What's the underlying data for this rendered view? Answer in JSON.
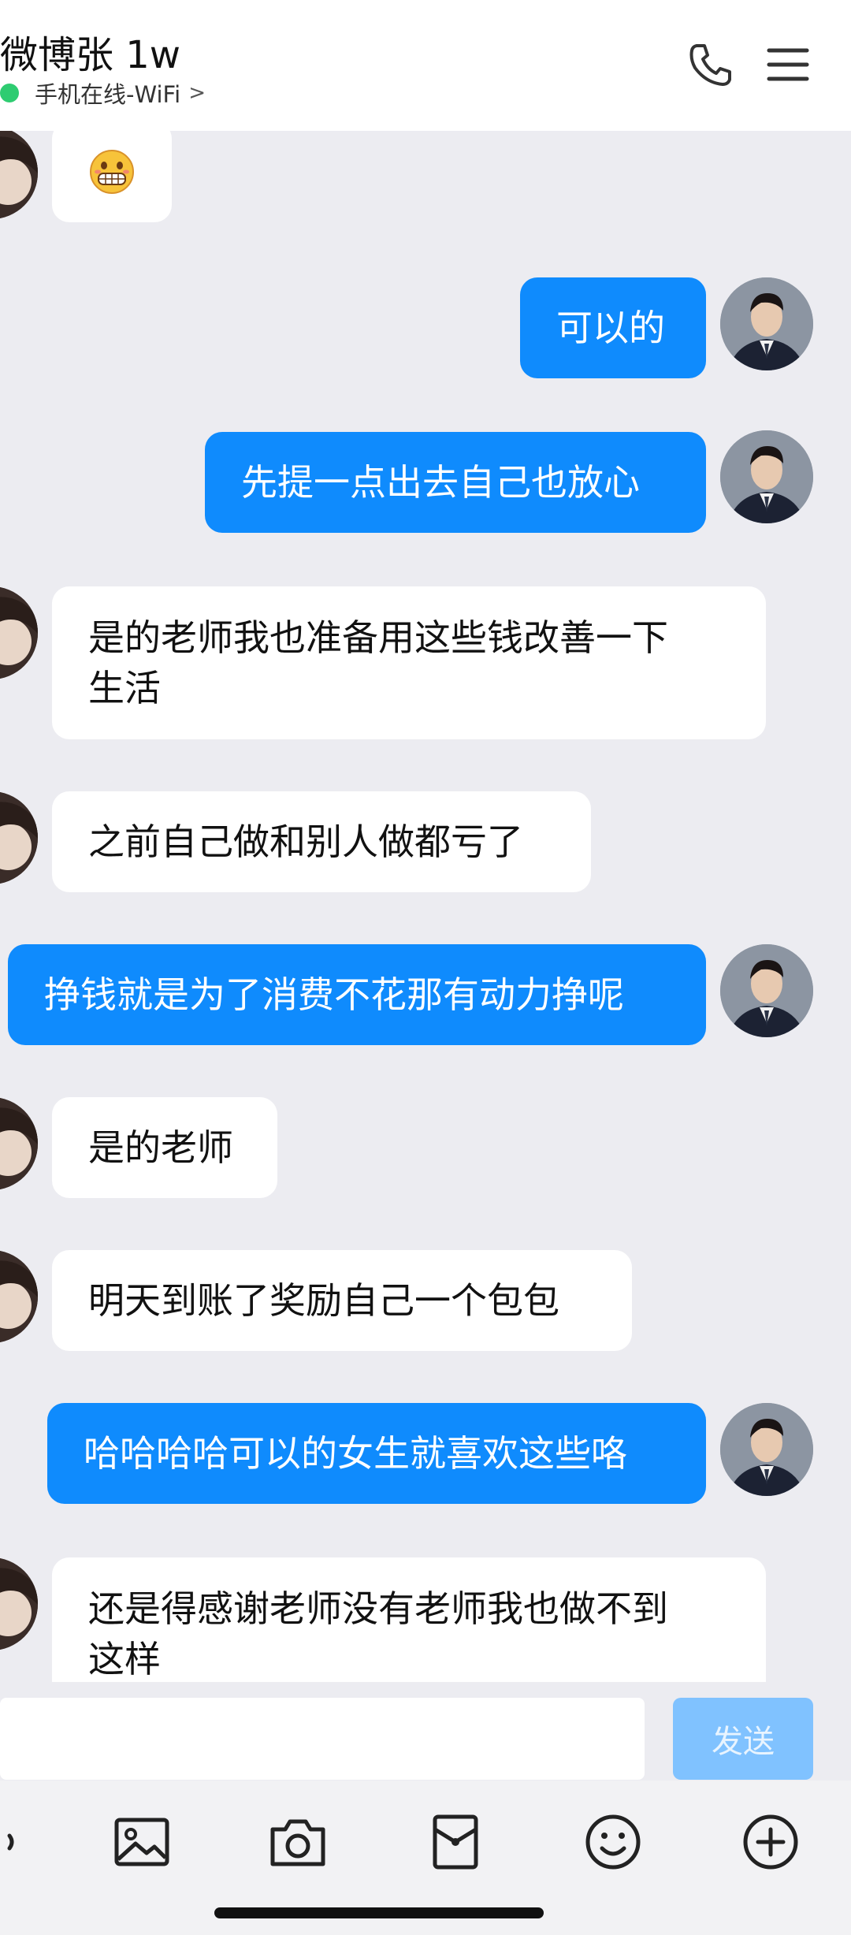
{
  "header": {
    "title": "微博张 1w",
    "status": "手机在线-WiFi",
    "status_chevron": ">",
    "status_color": "#2ecc71"
  },
  "messages": [
    {
      "from": "them",
      "type": "emoji",
      "icon": "grinning-face-emoji"
    },
    {
      "from": "me",
      "text": "可以的"
    },
    {
      "from": "me",
      "text": "先提一点出去自己也放心"
    },
    {
      "from": "them",
      "lines": [
        "是的老师我也准备用这些钱改善一下",
        "生活"
      ]
    },
    {
      "from": "them",
      "text": "之前自己做和别人做都亏了"
    },
    {
      "from": "me",
      "text": "挣钱就是为了消费不花那有动力挣呢"
    },
    {
      "from": "them",
      "text": "是的老师"
    },
    {
      "from": "them",
      "text": "明天到账了奖励自己一个包包"
    },
    {
      "from": "me",
      "text": "哈哈哈哈可以的女生就喜欢这些咯"
    },
    {
      "from": "them",
      "lines": [
        "还是得感谢老师没有老师我也做不到",
        "这样"
      ]
    }
  ],
  "input": {
    "value": "",
    "send_label": "发送"
  },
  "toolbar": {
    "icons": [
      "image-icon",
      "camera-icon",
      "red-packet-icon",
      "emoji-icon",
      "plus-icon"
    ]
  },
  "colors": {
    "accent": "#0f8bfd",
    "background": "#ececf1",
    "send_disabled": "#80c2ff"
  }
}
